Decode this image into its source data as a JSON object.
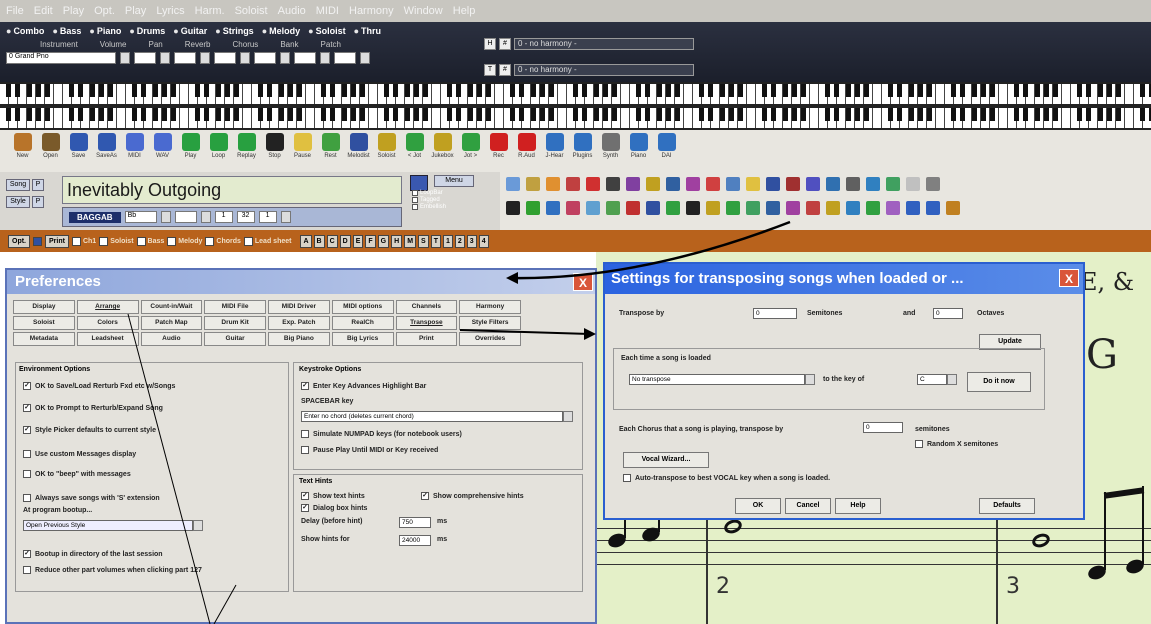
{
  "menu": [
    "File",
    "Edit",
    "Play",
    "Opt.",
    "Play",
    "Lyrics",
    "Harm.",
    "Soloist",
    "Audio",
    "MIDI",
    "Harmony",
    "Window",
    "Help"
  ],
  "tracks": [
    "Combo",
    "Bass",
    "Piano",
    "Drums",
    "Guitar",
    "Strings",
    "Melody",
    "Soloist",
    "Thru"
  ],
  "track_subheads": [
    "Instrument",
    "Volume",
    "Pan",
    "Reverb",
    "Chorus",
    "Bank",
    "Patch"
  ],
  "instrument_value": "0 Grand Pno",
  "harmony_select_1": "0 - no harmony -",
  "harmony_select_2": "0 - no harmony -",
  "toolbar": [
    {
      "label": "New",
      "color": "#b8742a"
    },
    {
      "label": "Open",
      "color": "#7a5a2a"
    },
    {
      "label": "Save",
      "color": "#3058b0"
    },
    {
      "label": "SaveAs",
      "color": "#3058b0"
    },
    {
      "label": "MIDI",
      "color": "#4a6ad0"
    },
    {
      "label": "WAV",
      "color": "#4a6ad0"
    },
    {
      "label": "Play",
      "color": "#28a040"
    },
    {
      "label": "Loop",
      "color": "#28a040"
    },
    {
      "label": "Replay",
      "color": "#28a040"
    },
    {
      "label": "Stop",
      "color": "#222222"
    },
    {
      "label": "Pause",
      "color": "#e0c040"
    },
    {
      "label": "Rest",
      "color": "#40a040"
    },
    {
      "label": "Melodist",
      "color": "#3050a0"
    },
    {
      "label": "Soloist",
      "color": "#c0a020"
    },
    {
      "label": "< Jot",
      "color": "#30a040"
    },
    {
      "label": "Jukebox",
      "color": "#c0a020"
    },
    {
      "label": "Jot >",
      "color": "#30a040"
    },
    {
      "label": "Rec",
      "color": "#d02020"
    },
    {
      "label": "R.Aud",
      "color": "#d02020"
    },
    {
      "label": "J-Hear",
      "color": "#3070c0"
    },
    {
      "label": "Plugins",
      "color": "#3070c0"
    },
    {
      "label": "Synth",
      "color": "#707070"
    },
    {
      "label": "Piano",
      "color": "#3070c0"
    },
    {
      "label": "DAI",
      "color": "#3070c0"
    }
  ],
  "song": {
    "title": "Inevitably Outgoing",
    "key": "BAGGAB",
    "key_val": "Bb",
    "tempo": "1",
    "chorus_from": "32",
    "chorus_to": "1",
    "side_song": "Song",
    "side_style": "Style",
    "menu_btn": "Menu",
    "checks": [
      "LoopBar",
      "Tagged",
      "Embellish"
    ]
  },
  "orangebar": {
    "opt": "Opt.",
    "print": "Print",
    "ch_label": "Ch",
    "voice_opts": [
      "Ch1",
      "Soloist",
      "Bass",
      "Melody",
      "Chords",
      "Lead sheet"
    ],
    "letters": [
      "A",
      "B",
      "C",
      "D",
      "E",
      "F",
      "G",
      "H",
      "M",
      "S",
      "T",
      "1",
      "2",
      "3",
      "4"
    ]
  },
  "prefs": {
    "title": "Preferences",
    "close": "X",
    "tabs": [
      "Display",
      "Arrange",
      "Count-in/Wait",
      "MIDI File",
      "MIDI Driver",
      "MIDI options",
      "Channels",
      "Harmony",
      "Soloist",
      "Colors",
      "Patch Map",
      "Drum Kit",
      "Exp. Patch",
      "RealCh",
      "Transpose",
      "Style Filters",
      "Metadata",
      "Leadsheet",
      "Audio",
      "Guitar",
      "Big Piano",
      "Big Lyrics",
      "Print",
      "Overrides"
    ],
    "env_title": "Environment Options",
    "env_opts": [
      {
        "label": "OK to Save/Load Rerturb Fxd etc w/Songs",
        "checked": true
      },
      {
        "label": "OK to Prompt to Rerturb/Expand Song",
        "checked": true
      },
      {
        "label": "Style Picker defaults to current style",
        "checked": true
      },
      {
        "label": "Use custom Messages display",
        "checked": false
      },
      {
        "label": "OK to \"beep\" with messages",
        "checked": false
      },
      {
        "label": "Always save songs with 'S' extension",
        "checked": false
      }
    ],
    "startup_label": "At program bootup...",
    "startup_value": "Open Previous Style",
    "bottom_opts": [
      {
        "label": "Bootup in directory of the last session",
        "checked": true
      },
      {
        "label": "Reduce other part volumes when clicking part 127",
        "checked": false
      }
    ],
    "kb_title": "Keystroke Options",
    "kb_opt": "Enter Key Advances Highlight Bar",
    "spacebar_label": "SPACEBAR key",
    "spacebar_value": "Enter no chord (deletes current chord)",
    "kb_opts2": [
      "Simulate NUMPAD keys (for notebook users)",
      "Pause Play Until MIDI or Key received"
    ],
    "hints_title": "Text Hints",
    "show_text_hints": "Show text hints",
    "show_comp_hints": "Show comprehensive hints",
    "dialog_hints": "Dialog box hints",
    "delay_label": "Delay (before hint)",
    "delay_value": "750",
    "show_for_label": "Show hints for",
    "show_for_value": "24000",
    "ms": "ms"
  },
  "transpose": {
    "title": "Settings for transposing songs when loaded or ...",
    "close": "X",
    "transpose_by": "Transpose by",
    "semitones_value": "0",
    "semitones": "Semitones",
    "and": "and",
    "octaves_value": "0",
    "octaves": "Octaves",
    "update": "Update",
    "each_time": "Each time a song is loaded",
    "mode_value": "No transpose",
    "to_key_of": "to the key of",
    "key_value": "C",
    "do_it_now": "Do it now",
    "each_chorus": "Each Chorus that a song is playing, transpose by",
    "chorus_value": "0",
    "chorus_semitones": "semitones",
    "random": "Random X semitones",
    "vocal_wizard": "Vocal Wizard...",
    "auto_vocal": "Auto-transpose to best VOCAL key when a song is loaded.",
    "ok": "OK",
    "cancel": "Cancel",
    "help": "Help",
    "defaults": "Defaults"
  },
  "sheet": {
    "text": "E, &",
    "measure_2": "2",
    "measure_3": "3"
  }
}
